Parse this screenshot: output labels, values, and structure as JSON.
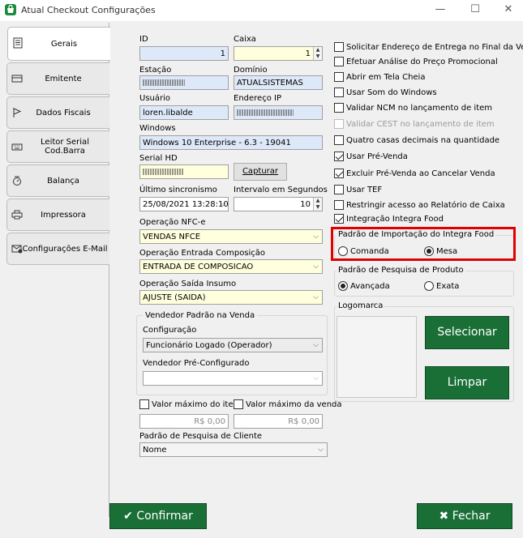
{
  "window": {
    "title": "Atual Checkout Configurações"
  },
  "sidebar": {
    "tabs": [
      {
        "label": "Gerais",
        "icon": "document-icon"
      },
      {
        "label": "Emitente",
        "icon": "card-icon"
      },
      {
        "label": "Dados Fiscais",
        "icon": "flag-icon"
      },
      {
        "label": "Leitor Serial Cod.Barra",
        "icon": "keyboard-icon"
      },
      {
        "label": "Balança",
        "icon": "scale-icon"
      },
      {
        "label": "Impressora",
        "icon": "printer-icon"
      },
      {
        "label": "Configurações E-Mail",
        "icon": "email-icon"
      }
    ]
  },
  "form": {
    "id_label": "ID",
    "id_value": "1",
    "caixa_label": "Caixa",
    "caixa_value": "1",
    "estacao_label": "Estação",
    "dominio_label": "Domínio",
    "dominio_value": "ATUALSISTEMAS",
    "usuario_label": "Usuário",
    "usuario_value": "loren.libalde",
    "ip_label": "Endereço IP",
    "windows_label": "Windows",
    "windows_value": "Windows 10 Enterprise - 6.3 - 19041",
    "serial_label": "Serial HD",
    "capturar_label": "Capturar",
    "ultimo_label": "Último sincronismo",
    "ultimo_value": "25/08/2021 13:28:10",
    "intervalo_label": "Intervalo em Segundos",
    "intervalo_value": "10",
    "nfce_label": "Operação NFC-e",
    "nfce_value": "VENDAS NFCE",
    "entrada_label": "Operação Entrada Composição",
    "entrada_value": "ENTRADA DE COMPOSICAO",
    "saida_label": "Operação Saída Insumo",
    "saida_value": "AJUSTE (SAIDA)",
    "vendedor_group": "Vendedor Padrão na Venda",
    "configuracao_label": "Configuração",
    "configuracao_value": "Funcionário Logado (Operador)",
    "preconf_label": "Vendedor Pré-Configurado",
    "preconf_value": "",
    "max_item_label": "Valor máximo do item",
    "max_item_value": "R$ 0,00",
    "max_venda_label": "Valor máximo da venda",
    "max_venda_value": "R$ 0,00",
    "cliente_label": "Padrão de Pesquisa de Cliente",
    "cliente_value": "Nome"
  },
  "options": [
    {
      "label": "Solicitar Endereço de Entrega no Final da Venda",
      "checked": false,
      "enabled": true
    },
    {
      "label": "Efetuar Análise do Preço Promocional",
      "checked": false,
      "enabled": true
    },
    {
      "label": "Abrir em Tela Cheia",
      "checked": false,
      "enabled": true
    },
    {
      "label": "Usar Som do Windows",
      "checked": false,
      "enabled": true
    },
    {
      "label": "Validar NCM no lançamento de item",
      "checked": false,
      "enabled": true
    },
    {
      "label": "Validar CEST no lançamento de item",
      "checked": false,
      "enabled": false
    },
    {
      "label": "Quatro casas decimais na quantidade",
      "checked": false,
      "enabled": true
    },
    {
      "label": "Usar Pré-Venda",
      "checked": true,
      "enabled": true
    },
    {
      "label": "Excluir Pré-Venda ao Cancelar Venda",
      "checked": true,
      "enabled": true
    },
    {
      "label": "Usar TEF",
      "checked": false,
      "enabled": true
    },
    {
      "label": "Restringir acesso ao Relatório de Caixa",
      "checked": false,
      "enabled": true
    },
    {
      "label": "Integração Integra Food",
      "checked": true,
      "enabled": true
    }
  ],
  "integra": {
    "title": "Padrão de Importação do Integra Food",
    "opt1": "Comanda",
    "opt2": "Mesa"
  },
  "produto": {
    "title": "Padrão de Pesquisa de Produto",
    "opt1": "Avançada",
    "opt2": "Exata"
  },
  "logo": {
    "title": "Logomarca",
    "select": "Selecionar",
    "clear": "Limpar"
  },
  "footer": {
    "confirm": "Confirmar",
    "close": "Fechar"
  },
  "colors": {
    "accent_green": "#1a6f37",
    "highlight_red": "#e00000"
  }
}
